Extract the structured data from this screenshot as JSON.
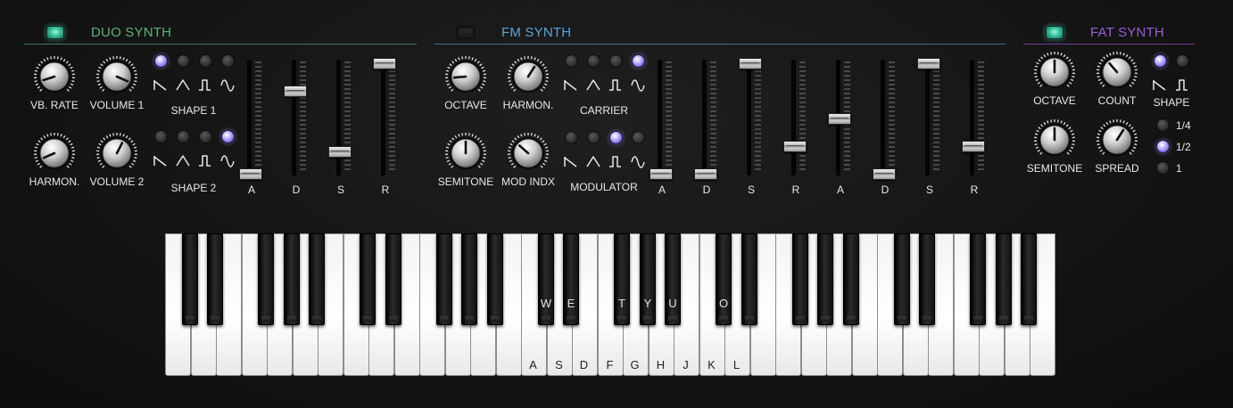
{
  "colors": {
    "duo_accent": "#5fb07a",
    "fm_accent": "#5aa3d6",
    "fat_accent": "#9b5fcf",
    "led_on": "#3bbf9a",
    "dot_on": "#b9a8ff"
  },
  "duo": {
    "title": "DUO SYNTH",
    "enabled": true,
    "knobs": {
      "vb_rate": "VB. RATE",
      "volume1": "VOLUME 1",
      "harmon": "HARMON.",
      "volume2": "VOLUME 2"
    },
    "knob_values": {
      "vb_rate": 0.1,
      "volume1": 0.92,
      "harmon": 0.08,
      "volume2": 0.6
    },
    "shape1_label": "SHAPE 1",
    "shape1_selected": 0,
    "shape2_label": "SHAPE 2",
    "shape2_selected": 3,
    "adsr": {
      "labels": [
        "A",
        "D",
        "S",
        "R"
      ],
      "values": [
        0.0,
        0.75,
        0.2,
        1.0
      ]
    }
  },
  "fm": {
    "title": "FM SYNTH",
    "enabled": false,
    "knobs": {
      "octave": "OCTAVE",
      "harmon": "HARMON.",
      "semitone": "SEMITONE",
      "mod_indx": "MOD INDX"
    },
    "knob_values": {
      "octave": 0.15,
      "harmon": 0.62,
      "semitone": 0.5,
      "mod_indx": 0.32
    },
    "carrier_label": "CARRIER",
    "carrier_selected": 3,
    "modulator_label": "MODULATOR",
    "modulator_selected": 2,
    "adsr": {
      "labels": [
        "A",
        "D",
        "S",
        "R",
        "A",
        "D",
        "S",
        "R"
      ],
      "values": [
        0.0,
        0.0,
        1.0,
        0.25,
        0.5,
        0.0,
        1.0,
        0.25
      ]
    }
  },
  "fat": {
    "title": "FAT SYNTH",
    "enabled": true,
    "knobs": {
      "octave": "OCTAVE",
      "count": "COUNT",
      "semitone": "SEMITONE",
      "spread": "SPREAD"
    },
    "knob_values": {
      "octave": 0.5,
      "count": 0.35,
      "semitone": 0.5,
      "spread": 0.62
    },
    "shape_label": "SHAPE",
    "shape_selected": 0,
    "spread_options": [
      "1/4",
      "1/2",
      "1"
    ],
    "spread_selected": 1
  },
  "keyboard": {
    "white_labels": {
      "14": "A",
      "15": "S",
      "16": "D",
      "17": "F",
      "18": "G",
      "19": "H",
      "20": "J",
      "21": "K",
      "22": "L"
    },
    "black_labels": {
      "10": "W",
      "11": "E",
      "12": "T",
      "13": "Y",
      "14": "U",
      "15": "O"
    }
  }
}
